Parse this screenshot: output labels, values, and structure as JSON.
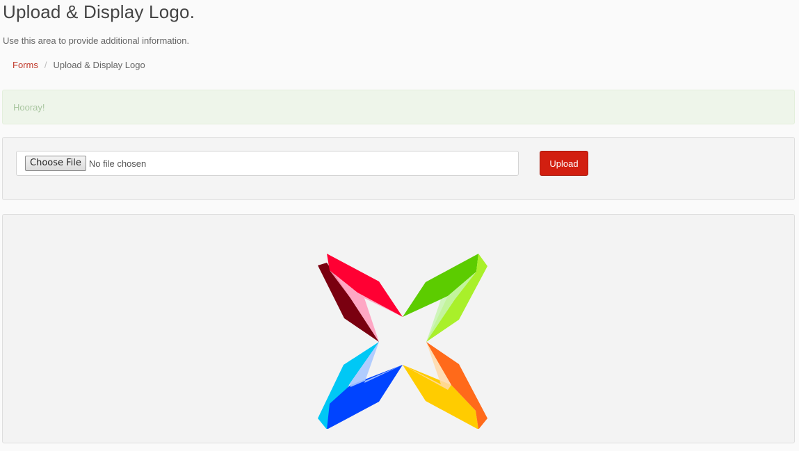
{
  "header": {
    "title": "Upload & Display Logo.",
    "subtitle": "Use this area to provide additional information."
  },
  "breadcrumb": {
    "items": [
      {
        "label": "Forms",
        "link": true
      },
      {
        "label": "Upload & Display Logo",
        "link": false
      }
    ],
    "separator": "/"
  },
  "alert": {
    "message": "Hooray!",
    "type": "success"
  },
  "upload_form": {
    "choose_file_label": "Choose File",
    "file_status": "No file chosen",
    "upload_button_label": "Upload",
    "upload_button_color": "#d21f10"
  },
  "logo_display": {
    "icon": "pinwheel-logo",
    "petal_colors": {
      "top_left": [
        "#ff0033",
        "#7a0010",
        "#ff9fbf"
      ],
      "top_right": [
        "#5ccc00",
        "#a9f02a",
        "#c8f5b0"
      ],
      "bottom_left": [
        "#0044ff",
        "#00c8f5",
        "#a8c8ff"
      ],
      "bottom_right": [
        "#ffcc00",
        "#ff6a1a",
        "#ffd9a8"
      ]
    }
  },
  "colors": {
    "accent": "#c0392b",
    "alert_bg": "#eef5ea",
    "panel_bg": "#f4f4f4"
  }
}
